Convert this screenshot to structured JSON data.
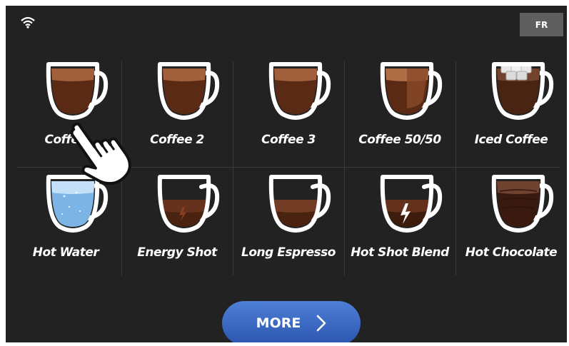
{
  "header": {
    "wifi_icon": "wifi-icon",
    "language_button": "FR"
  },
  "drinks": [
    {
      "label": "Coffee",
      "type": "coffee"
    },
    {
      "label": "Coffee 2",
      "type": "coffee"
    },
    {
      "label": "Coffee 3",
      "type": "coffee"
    },
    {
      "label": "Coffee 50/50",
      "type": "coffee-split"
    },
    {
      "label": "Iced Coffee",
      "type": "iced"
    },
    {
      "label": "Hot Water",
      "type": "water"
    },
    {
      "label": "Energy Shot",
      "type": "energy"
    },
    {
      "label": "Long Espresso",
      "type": "long"
    },
    {
      "label": "Hot Shot Blend",
      "type": "hotshot"
    },
    {
      "label": "Hot Chocolate",
      "type": "chocolate"
    }
  ],
  "footer": {
    "more_label": "MORE"
  },
  "colors": {
    "background": "#222222",
    "button": "#3b66c4",
    "coffee": "#6b3a22",
    "water": "#8ec3ea"
  }
}
